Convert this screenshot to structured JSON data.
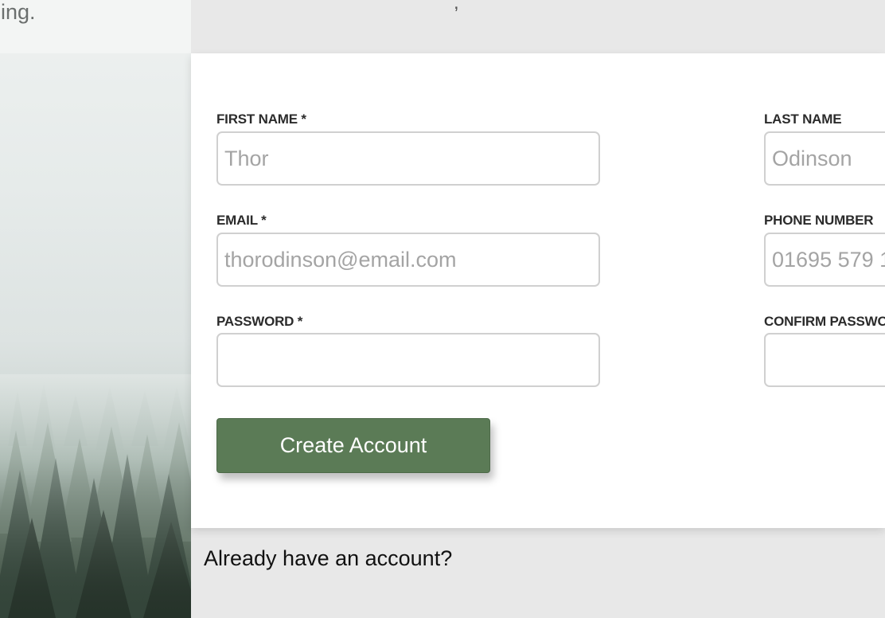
{
  "left_panel": {
    "caption_text": "ning."
  },
  "top_strip": {
    "glyph": ","
  },
  "form": {
    "first_name": {
      "label": "FIRST NAME *",
      "placeholder": "Thor",
      "value": ""
    },
    "last_name": {
      "label": "LAST NAME",
      "placeholder": "Odinson",
      "value": ""
    },
    "email": {
      "label": "EMAIL *",
      "placeholder": "thorodinson@email.com",
      "value": ""
    },
    "phone": {
      "label": "PHONE NUMBER",
      "placeholder": "01695 579 1",
      "value": ""
    },
    "password": {
      "label": "PASSWORD *",
      "placeholder": "",
      "value": ""
    },
    "confirm_password": {
      "label": "CONFIRM PASSWOR",
      "placeholder": "",
      "value": ""
    },
    "submit_label": "Create Account"
  },
  "footer": {
    "already_text": "Already have an account?"
  },
  "colors": {
    "button": "#5b7b56",
    "background": "#e8e8e8",
    "card": "#ffffff"
  }
}
